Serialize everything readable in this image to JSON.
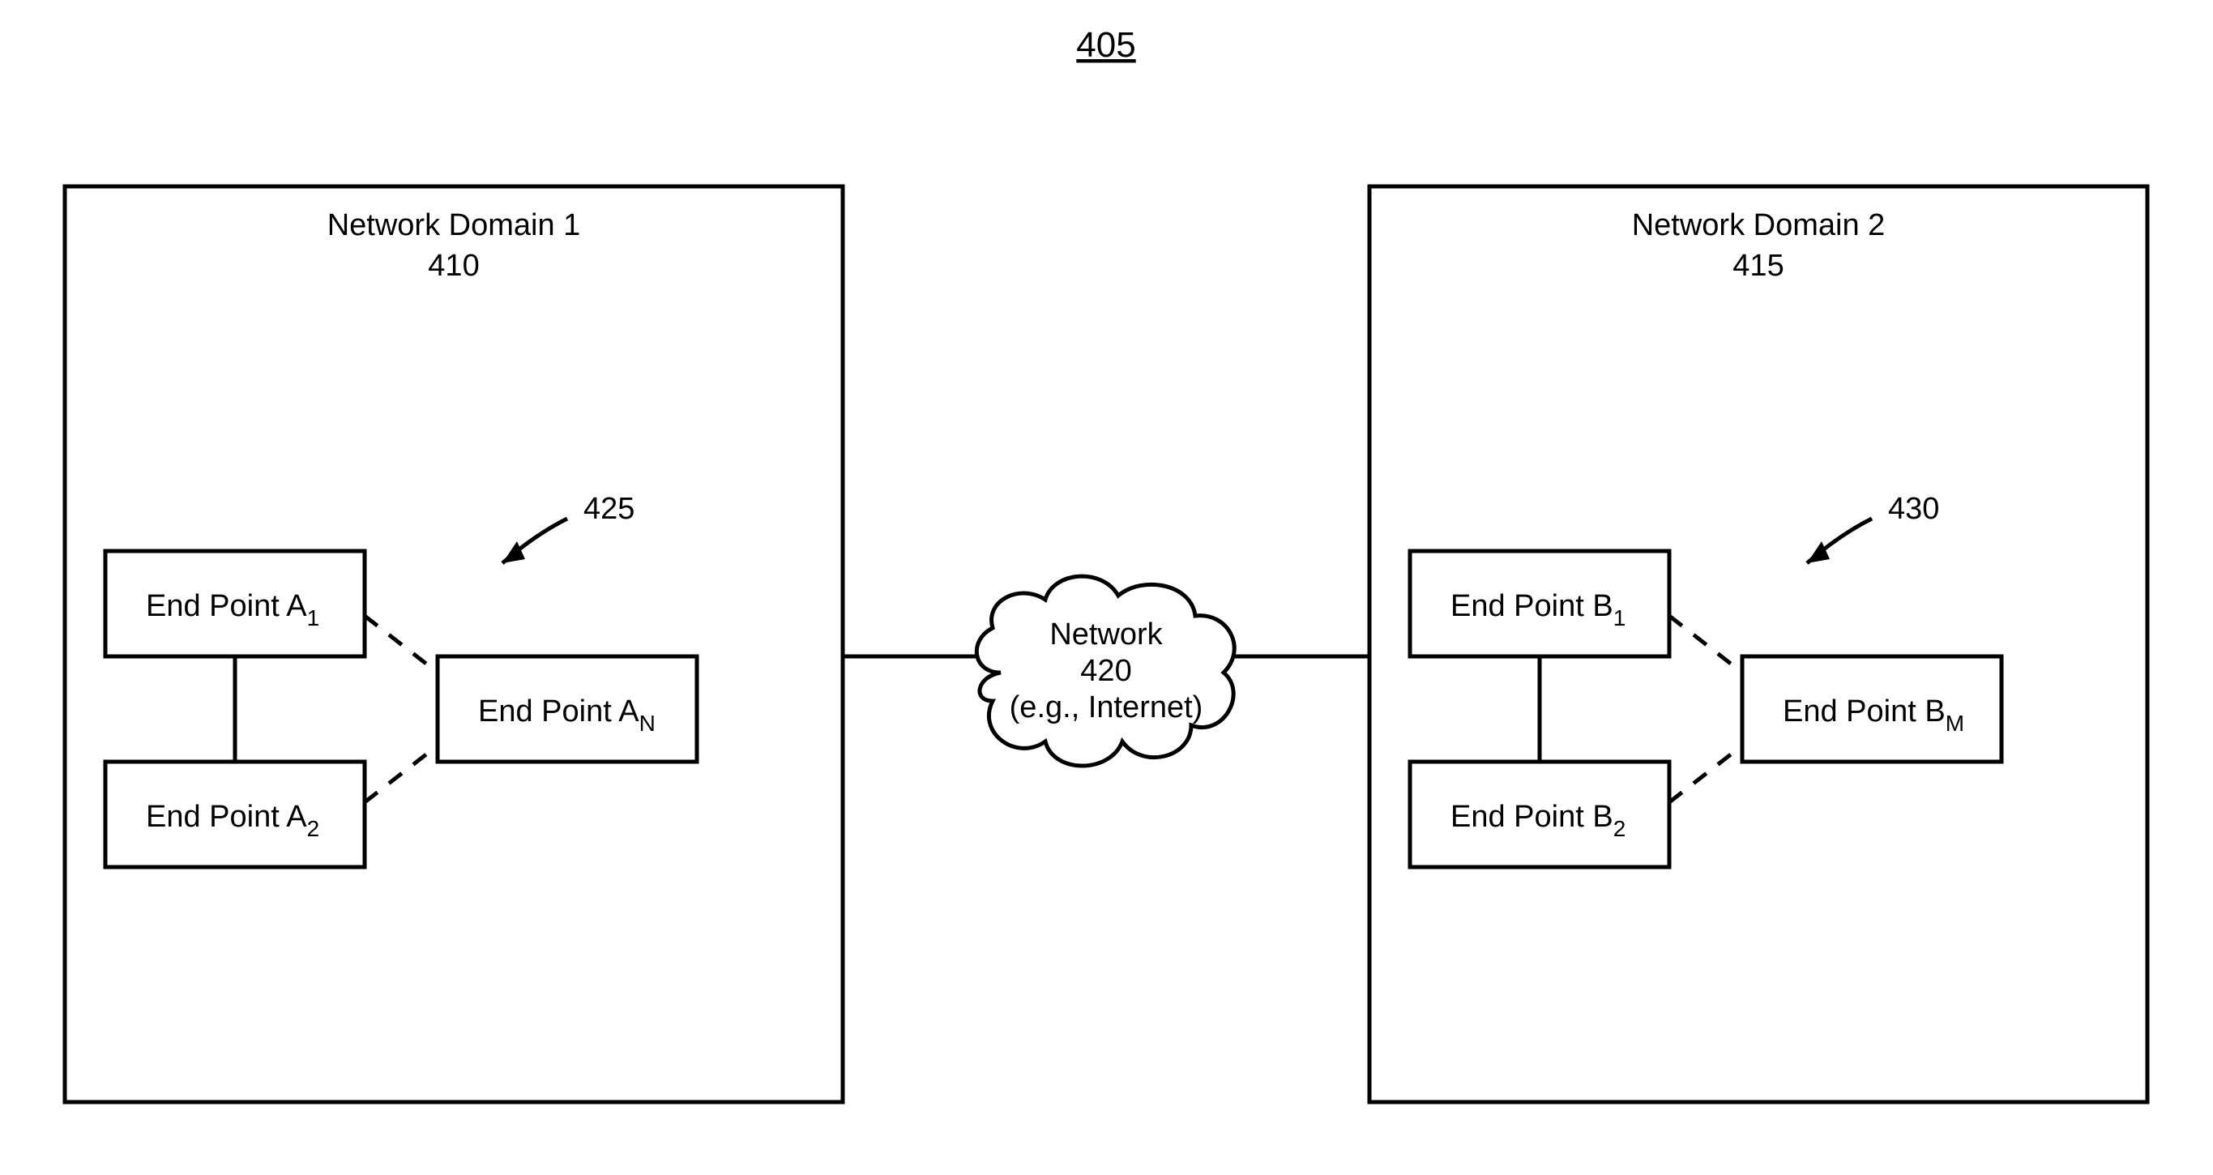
{
  "figure_ref": "405",
  "domain1": {
    "title": "Network Domain 1",
    "ref": "410",
    "ep1": {
      "label": "End Point A",
      "sub": "1"
    },
    "ep2": {
      "label": "End Point A",
      "sub": "2"
    },
    "epN": {
      "label": "End Point A",
      "sub": "N"
    },
    "callout": "425"
  },
  "domain2": {
    "title": "Network Domain 2",
    "ref": "415",
    "ep1": {
      "label": "End Point B",
      "sub": "1"
    },
    "ep2": {
      "label": "End Point B",
      "sub": "2"
    },
    "epM": {
      "label": "End Point B",
      "sub": "M"
    },
    "callout": "430"
  },
  "network": {
    "line1": "Network",
    "line2": "420",
    "line3": "(e.g., Internet)"
  }
}
